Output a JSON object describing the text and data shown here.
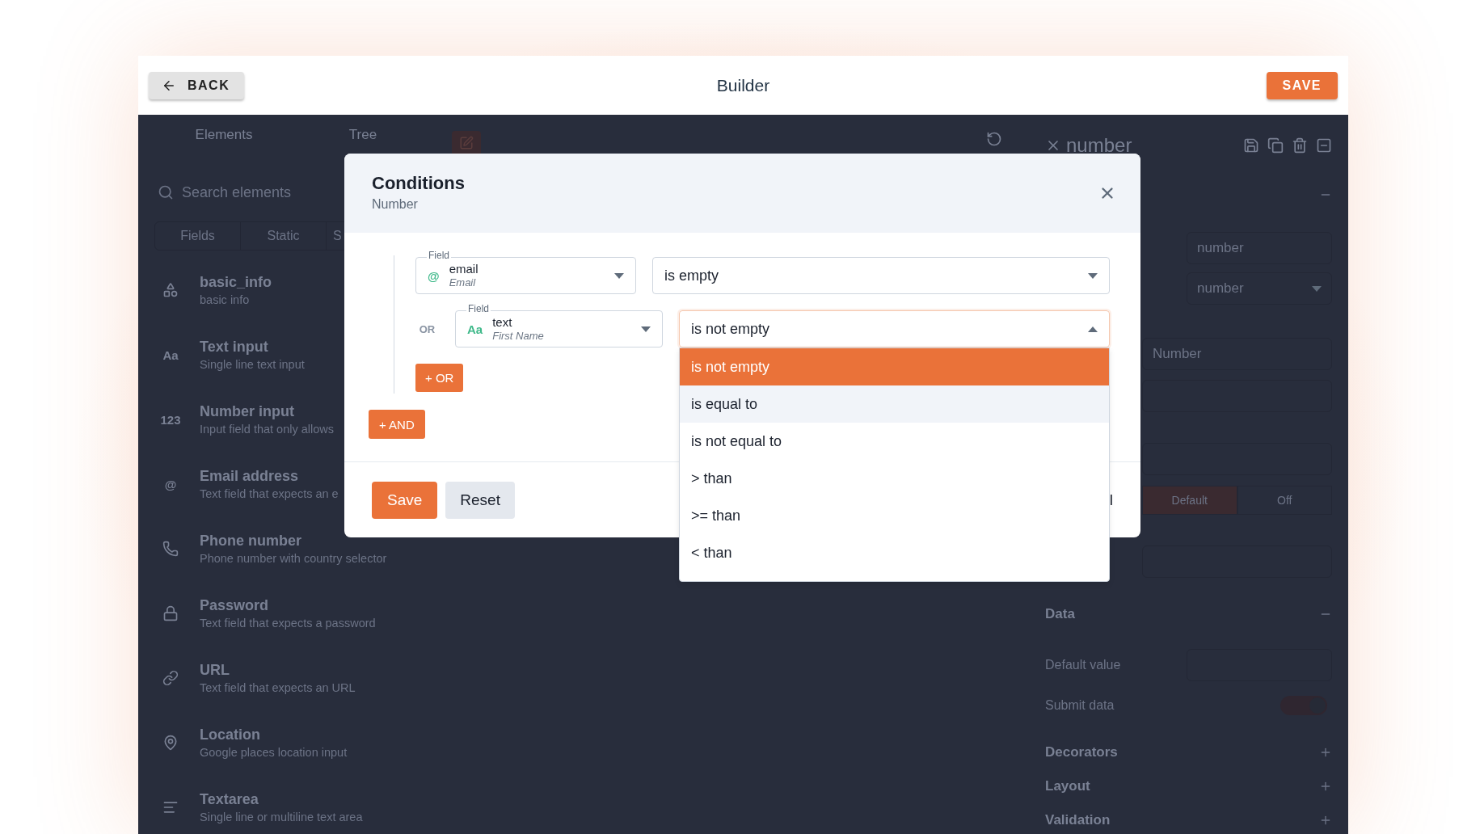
{
  "header": {
    "back": "BACK",
    "title": "Builder",
    "save": "SAVE"
  },
  "left_panel": {
    "tabs": [
      {
        "label": "Elements"
      },
      {
        "label": "Tree"
      }
    ],
    "search": {
      "placeholder": "Search elements"
    },
    "categories": [
      {
        "label": "Fields"
      },
      {
        "label": "Static"
      },
      {
        "label": "S"
      }
    ],
    "elements": [
      {
        "kind": "shapes",
        "title": "basic_info",
        "description": "basic info"
      },
      {
        "kind": "glyph",
        "glyph": "Aa",
        "title": "Text input",
        "description": "Single line text input"
      },
      {
        "kind": "glyph",
        "glyph": "123",
        "title": "Number input",
        "description": "Input field that only allows"
      },
      {
        "kind": "glyph",
        "glyph": "@",
        "title": "Email address",
        "description": "Text field that expects an e"
      },
      {
        "kind": "phone",
        "title": "Phone number",
        "description": "Phone number with country selector"
      },
      {
        "kind": "lock",
        "title": "Password",
        "description": "Text field that expects a password"
      },
      {
        "kind": "link",
        "title": "URL",
        "description": "Text field that expects an URL"
      },
      {
        "kind": "pin",
        "title": "Location",
        "description": "Google places location input"
      },
      {
        "kind": "lines",
        "title": "Textarea",
        "description": "Single line or multiline text area"
      }
    ]
  },
  "right_panel": {
    "title": "number",
    "name_value": "number",
    "type_value": "number",
    "label_value": "Number",
    "size_options": [
      {
        "label": "Default",
        "selected": true
      },
      {
        "label": "Off",
        "selected": false
      }
    ],
    "data_section": {
      "title": "Data",
      "expanded": true,
      "default_value_label": "Default value",
      "submit_label": "Submit data",
      "submit_on": true
    },
    "sections": [
      {
        "title": "Decorators",
        "expanded": false
      },
      {
        "title": "Layout",
        "expanded": false
      },
      {
        "title": "Validation",
        "expanded": false
      }
    ]
  },
  "modal": {
    "title": "Conditions",
    "subtitle": "Number",
    "conditions": [
      {
        "field_label": "Field",
        "field": "email",
        "field_type": "Email",
        "field_icon": "@",
        "operator": "is empty",
        "open": false
      },
      {
        "connector": "OR",
        "field_label": "Field",
        "field": "text",
        "field_type": "First Name",
        "field_icon": "Aa",
        "operator": "is not empty",
        "open": true
      }
    ],
    "add_or": "+ OR",
    "add_and": "+ AND",
    "operator_options": [
      {
        "label": "is not empty",
        "selected": true,
        "highlighted": false
      },
      {
        "label": "is equal to",
        "selected": false,
        "highlighted": true
      },
      {
        "label": "is not equal to",
        "selected": false,
        "highlighted": false
      },
      {
        "label": "> than",
        "selected": false,
        "highlighted": false
      },
      {
        "label": ">= than",
        "selected": false,
        "highlighted": false
      },
      {
        "label": "< than",
        "selected": false,
        "highlighted": false
      }
    ],
    "footer": {
      "save": "Save",
      "reset": "Reset",
      "partial_button": "l"
    }
  }
}
